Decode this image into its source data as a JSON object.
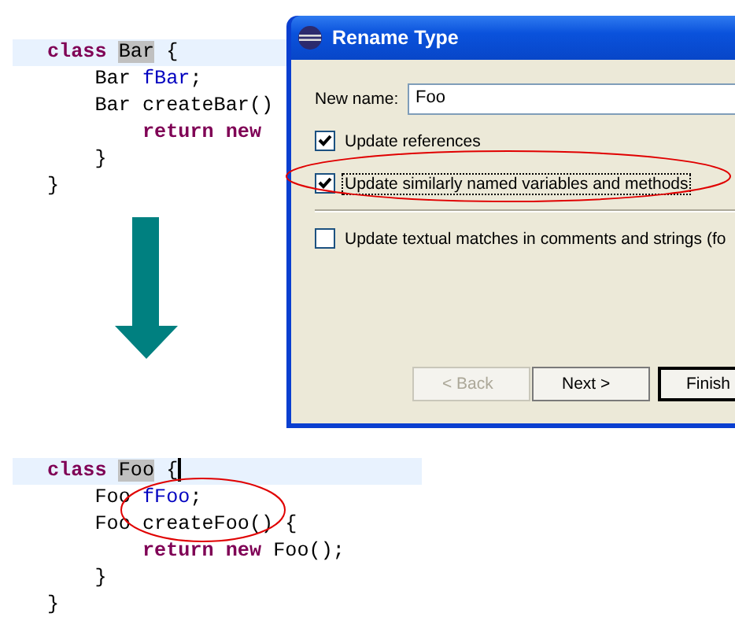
{
  "code_before": {
    "lines": [
      {
        "current": true,
        "tokens": [
          {
            "text": "class ",
            "kind": "keyword"
          },
          {
            "text": "Bar",
            "kind": "occurrence"
          },
          {
            "text": " {",
            "kind": "plain"
          }
        ]
      },
      {
        "current": false,
        "tokens": [
          {
            "text": "    Bar ",
            "kind": "plain"
          },
          {
            "text": "fBar",
            "kind": "field"
          },
          {
            "text": ";",
            "kind": "plain"
          }
        ]
      },
      {
        "current": false,
        "tokens": [
          {
            "text": "    Bar createBar()",
            "kind": "plain"
          }
        ]
      },
      {
        "current": false,
        "tokens": [
          {
            "text": "        return new",
            "kind": "keyword"
          }
        ]
      },
      {
        "current": false,
        "tokens": [
          {
            "text": "    }",
            "kind": "plain"
          }
        ]
      },
      {
        "current": false,
        "tokens": [
          {
            "text": "}",
            "kind": "plain"
          }
        ]
      }
    ]
  },
  "code_after": {
    "caret": true,
    "lines": [
      {
        "current": true,
        "tokens": [
          {
            "text": "class ",
            "kind": "keyword"
          },
          {
            "text": "Foo",
            "kind": "occurrence"
          },
          {
            "text": " {",
            "kind": "plain"
          }
        ]
      },
      {
        "current": false,
        "tokens": [
          {
            "text": "    Foo ",
            "kind": "plain"
          },
          {
            "text": "fFoo",
            "kind": "field"
          },
          {
            "text": ";",
            "kind": "plain"
          }
        ]
      },
      {
        "current": false,
        "tokens": [
          {
            "text": "    Foo createFoo() {",
            "kind": "plain"
          }
        ]
      },
      {
        "current": false,
        "tokens": [
          {
            "text": "        return new",
            "kind": "keyword"
          },
          {
            "text": " Foo();",
            "kind": "plain"
          }
        ]
      },
      {
        "current": false,
        "tokens": [
          {
            "text": "    }",
            "kind": "plain"
          }
        ]
      },
      {
        "current": false,
        "tokens": [
          {
            "text": "}",
            "kind": "plain"
          }
        ]
      }
    ]
  },
  "dialog": {
    "title": "Rename Type",
    "name_label": "New name:",
    "name_value": "Foo",
    "option_groups": [
      [
        {
          "label": "Update references",
          "checked": true,
          "focused": false
        },
        {
          "label": "Update similarly named variables and methods",
          "checked": true,
          "focused": true
        }
      ],
      [
        {
          "label": "Update textual matches in comments and strings (fo",
          "checked": false,
          "focused": false
        }
      ]
    ],
    "buttons": [
      {
        "label": "< Back",
        "disabled": true,
        "default": false
      },
      {
        "label": "Next >",
        "disabled": false,
        "default": false
      },
      {
        "label": "Finish",
        "disabled": false,
        "default": true
      }
    ]
  }
}
